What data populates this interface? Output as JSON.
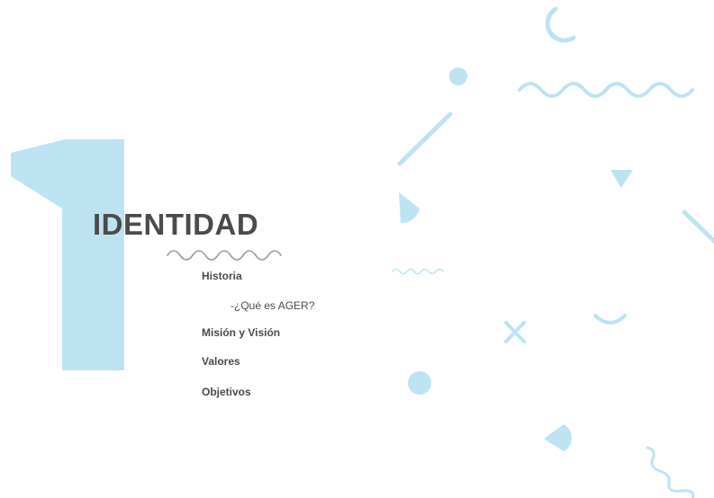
{
  "section": {
    "number": "1",
    "title": "IDENTIDAD"
  },
  "menu": {
    "items": [
      {
        "label": "Historia"
      },
      {
        "label": "-¿Qué es AGER?"
      },
      {
        "label": "Misión y Visión"
      },
      {
        "label": "Valores"
      },
      {
        "label": "Objetivos"
      }
    ]
  },
  "colors": {
    "accent_light_blue": "#bde3f3",
    "text_dark": "#4b4b4b",
    "wave_gray": "#9a9a9a"
  },
  "icons": [
    "big-number-one",
    "wavy-line-icon",
    "circle-icon",
    "triangle-icon",
    "half-circle-icon",
    "cross-icon",
    "arc-icon",
    "diagonal-line-icon"
  ]
}
